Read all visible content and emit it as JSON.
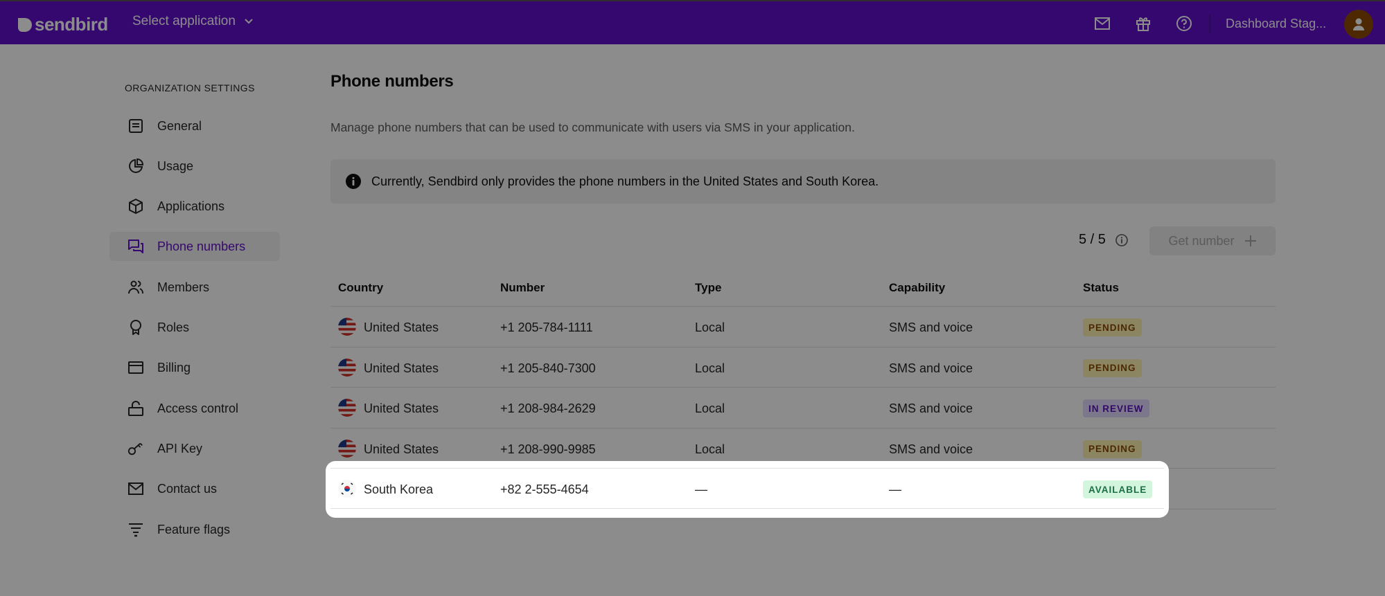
{
  "topbar": {
    "brand": "sendbird",
    "app_selector_label": "Select application",
    "icons": [
      "mail-icon",
      "gift-icon",
      "help-icon"
    ],
    "account_name": "Dashboard Stag...",
    "colors": {
      "brand": "#6210cc",
      "avatar": "#8d4a00"
    }
  },
  "sidebar": {
    "heading": "ORGANIZATION SETTINGS",
    "items": [
      {
        "label": "General",
        "icon": "document-icon",
        "active": false
      },
      {
        "label": "Usage",
        "icon": "pie-chart-icon",
        "active": false
      },
      {
        "label": "Applications",
        "icon": "cube-icon",
        "active": false
      },
      {
        "label": "Phone numbers",
        "icon": "chat-bubbles-icon",
        "active": true
      },
      {
        "label": "Members",
        "icon": "users-icon",
        "active": false
      },
      {
        "label": "Roles",
        "icon": "award-icon",
        "active": false
      },
      {
        "label": "Billing",
        "icon": "credit-card-icon",
        "active": false
      },
      {
        "label": "Access control",
        "icon": "unlock-icon",
        "active": false
      },
      {
        "label": "API Key",
        "icon": "key-icon",
        "active": false
      },
      {
        "label": "Contact us",
        "icon": "mail-icon",
        "active": false
      },
      {
        "label": "Feature flags",
        "icon": "filter-icon",
        "active": false
      }
    ]
  },
  "main": {
    "title": "Phone numbers",
    "description": "Manage phone numbers that can be used to communicate with users via SMS in your application.",
    "info_banner": "Currently, Sendbird only provides the phone numbers in the United States and South Korea.",
    "quota": "5 / 5",
    "get_number_label": "Get number",
    "table": {
      "columns": [
        "Country",
        "Number",
        "Type",
        "Capability",
        "Status"
      ],
      "rows": [
        {
          "country": "United States",
          "flag": "us",
          "number": "+1 205-784-1111",
          "type": "Local",
          "capability": "SMS and voice",
          "status": "PENDING"
        },
        {
          "country": "United States",
          "flag": "us",
          "number": "+1 205-840-7300",
          "type": "Local",
          "capability": "SMS and voice",
          "status": "PENDING"
        },
        {
          "country": "United States",
          "flag": "us",
          "number": "+1 208-984-2629",
          "type": "Local",
          "capability": "SMS and voice",
          "status": "IN REVIEW"
        },
        {
          "country": "United States",
          "flag": "us",
          "number": "+1 208-990-9985",
          "type": "Local",
          "capability": "SMS and voice",
          "status": "PENDING"
        },
        {
          "country": "South Korea",
          "flag": "kr",
          "number": "+82 2-555-4654",
          "type": "—",
          "capability": "—",
          "status": "AVAILABLE"
        }
      ]
    },
    "status_colors": {
      "PENDING": {
        "bg": "#fff2b3",
        "fg": "#8a4a00"
      },
      "IN REVIEW": {
        "bg": "#e4d9ff",
        "fg": "#5a10c0"
      },
      "AVAILABLE": {
        "bg": "#d4f5dd",
        "fg": "#1a6e45"
      }
    }
  }
}
